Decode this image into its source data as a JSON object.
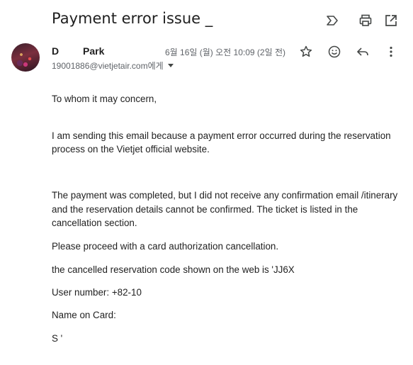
{
  "email": {
    "subject": "Payment error issue _",
    "sender": {
      "first_name": "D",
      "last_name": "Park",
      "address": "19001886@vietjetair.com에게"
    },
    "date": "6월 16일 (월) 오전 10:09 (2일 전)"
  },
  "body": {
    "greeting": "To whom it may concern,",
    "para1_line1": "I am sending this email because a payment error occurred during the reservation",
    "para1_line2": "process on the Vietjet official website.",
    "para2_line1": "The payment was completed, but I did not receive any confirmation email /itinerary",
    "para2_line2": "and the reservation details cannot be confirmed. The ticket is listed in the",
    "para2_line3": "cancellation section.",
    "para3": "Please proceed with a card authorization cancellation.",
    "para4": "the cancelled reservation code shown on the web is 'JJ6X",
    "user_number": "User number: +82-10",
    "name_on_card": "Name on Card:",
    "sign": "S '"
  },
  "icons": {
    "top": [
      "label-icon",
      "print-icon",
      "open-in-new-window-icon"
    ],
    "actions": [
      "star-icon",
      "emoji-icon",
      "reply-icon",
      "more-vert-icon"
    ]
  },
  "colors": {
    "text": "#1f1f1f",
    "muted": "#5f6368",
    "icon": "#444746"
  }
}
